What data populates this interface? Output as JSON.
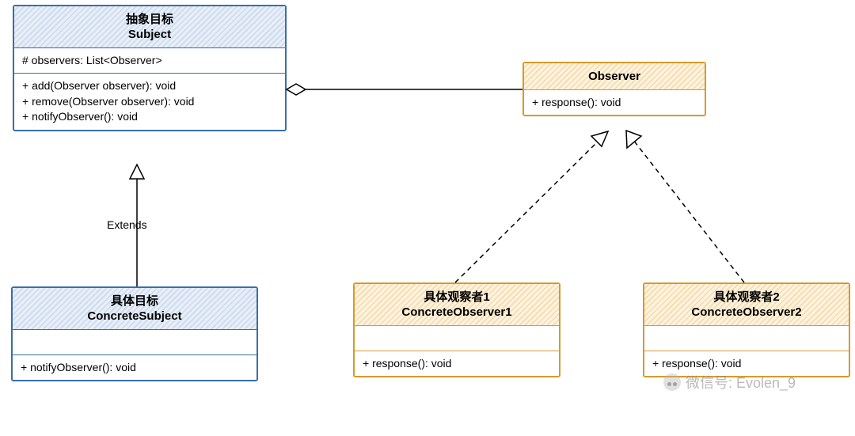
{
  "classes": {
    "subject": {
      "title_zh": "抽象目标",
      "title_en": "Subject",
      "attrs": "# observers: List<Observer>",
      "m1": "+ add(Observer observer): void",
      "m2": "+ remove(Observer observer): void",
      "m3": "+ notifyObserver(): void"
    },
    "concreteSubject": {
      "title_zh": "具体目标",
      "title_en": "ConcreteSubject",
      "m1": "+ notifyObserver(): void"
    },
    "observer": {
      "title_en": "Observer",
      "m1": "+ response(): void"
    },
    "concreteObserver1": {
      "title_zh": "具体观察者1",
      "title_en": "ConcreteObserver1",
      "m1": "+ response(): void"
    },
    "concreteObserver2": {
      "title_zh": "具体观察者2",
      "title_en": "ConcreteObserver2",
      "m1": "+ response(): void"
    }
  },
  "labels": {
    "extends": "Extends"
  },
  "watermark": {
    "text": "微信号: Evolen_9"
  }
}
